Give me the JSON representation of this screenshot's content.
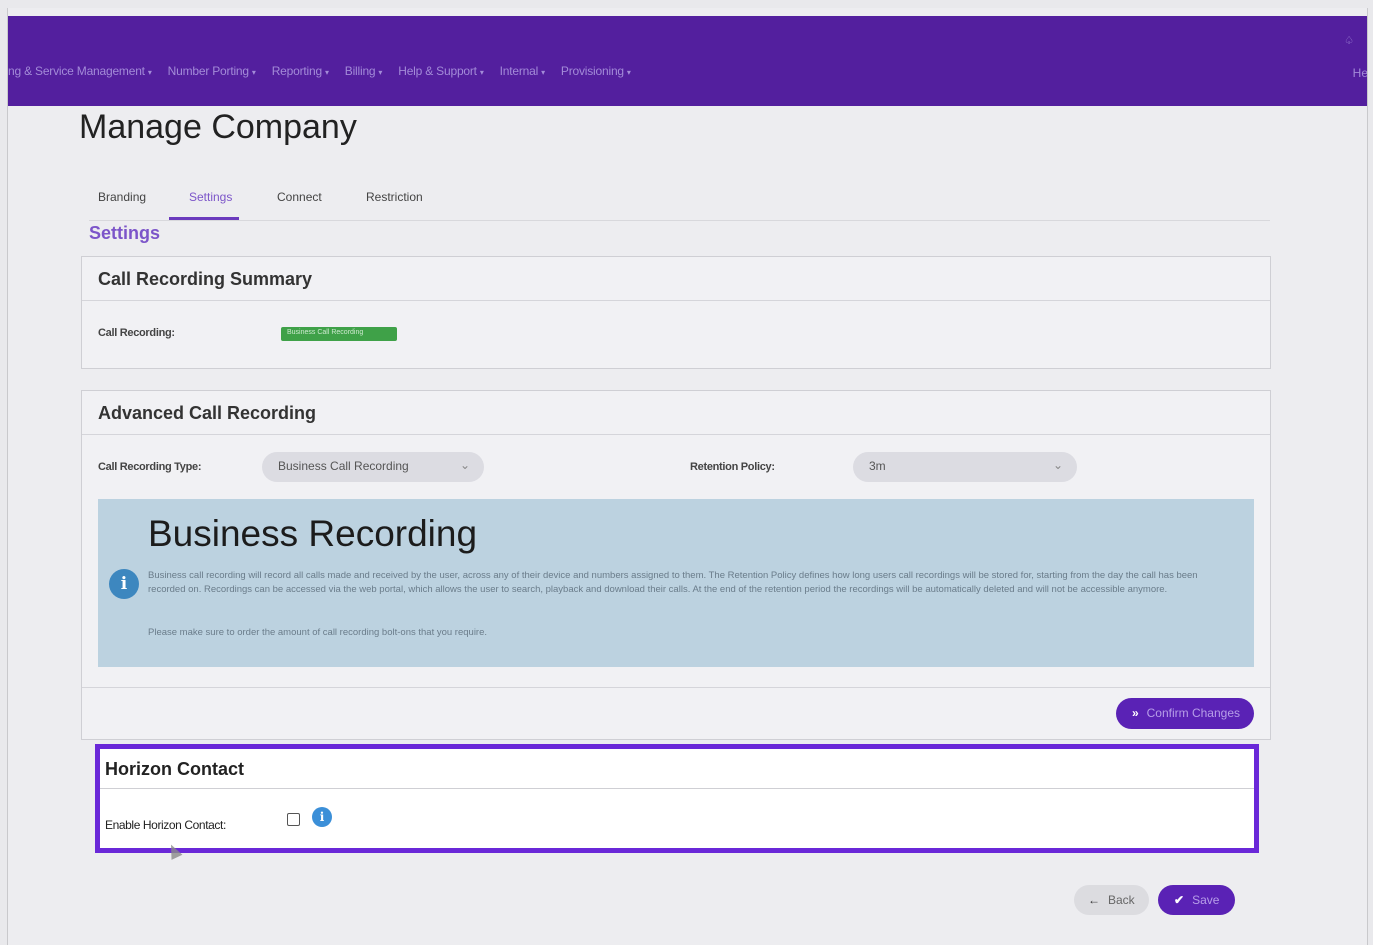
{
  "nav": {
    "items": [
      {
        "label": "ng & Service Management"
      },
      {
        "label": "Number Porting"
      },
      {
        "label": "Reporting"
      },
      {
        "label": "Billing"
      },
      {
        "label": "Help & Support"
      },
      {
        "label": "Internal"
      },
      {
        "label": "Provisioning"
      }
    ],
    "right_icon": "bell-icon",
    "right_text": "He"
  },
  "page": {
    "title": "Manage Company",
    "section": "Settings"
  },
  "tabs": [
    {
      "label": "Branding",
      "active": false
    },
    {
      "label": "Settings",
      "active": true
    },
    {
      "label": "Connect",
      "active": false
    },
    {
      "label": "Restriction",
      "active": false
    }
  ],
  "summary": {
    "title": "Call Recording Summary",
    "call_recording_label": "Call Recording:",
    "badge": "Business Call Recording"
  },
  "advanced": {
    "title": "Advanced Call Recording",
    "type_label": "Call Recording Type:",
    "type_value": "Business Call Recording",
    "retention_label": "Retention Policy:",
    "retention_value": "3m",
    "info_title": "Business Recording",
    "info_text": "Business call recording will record all calls made and received by the user, across any of their device and numbers assigned to them. The Retention Policy defines how long users call recordings will be stored for, starting from the day the call has been recorded on. Recordings can be accessed via the web portal, which allows the user to search, playback and download their calls. At the end of the retention period the recordings will be automatically deleted and will not be accessible anymore.",
    "info_note": "Please make sure to order the amount of call recording bolt-ons that you require.",
    "confirm_label": "Confirm Changes"
  },
  "horizon": {
    "title": "Horizon Contact",
    "enable_label": "Enable Horizon Contact:",
    "enabled": false
  },
  "actions": {
    "back_label": "Back",
    "save_label": "Save"
  },
  "colors": {
    "brand": "#531f9e",
    "accent": "#5a22b5",
    "highlight": "#6a28d8",
    "badge": "#3fa148",
    "info": "#3b8fd8"
  }
}
